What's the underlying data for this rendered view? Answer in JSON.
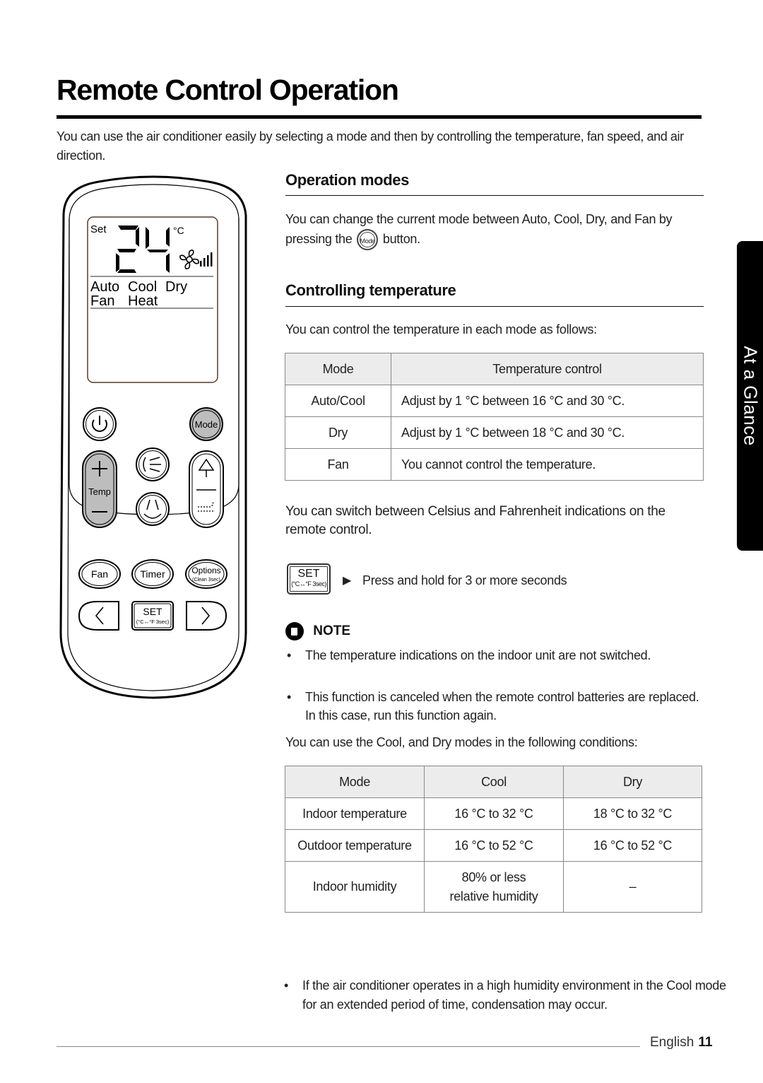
{
  "page": {
    "title": "Remote Control Operation",
    "intro": "You can use the air conditioner easily by selecting a mode and then by controlling the temperature, fan speed, and air direction.",
    "side_tab": "At a Glance",
    "footer": {
      "language": "English",
      "page_number": "11"
    }
  },
  "remote": {
    "lcd": {
      "set_label": "Set",
      "temperature": "24",
      "unit": "°C",
      "modes_row1": [
        "Auto",
        "Cool",
        "Dry"
      ],
      "modes_row2": [
        "Fan",
        "Heat"
      ]
    },
    "buttons": {
      "power_icon": "power-icon",
      "mode": "Mode",
      "temp": "Temp",
      "fan": "Fan",
      "timer": "Timer",
      "options": "Options",
      "options_sub": "(Clean 3sec)",
      "set": "SET",
      "set_sub": "(°C↔°F 3sec)"
    }
  },
  "operation_modes": {
    "heading": "Operation modes",
    "text_before": "You can change the current mode between Auto, Cool, Dry, and Fan by pressing the",
    "inline_button": "Mode",
    "text_after": "button."
  },
  "controlling_temperature": {
    "heading": "Controlling temperature",
    "lead": "You can control the temperature in each mode as follows:",
    "table": {
      "headers": [
        "Mode",
        "Temperature control"
      ],
      "rows": [
        [
          "Auto/Cool",
          "Adjust by 1 °C between 16 °C and 30 °C."
        ],
        [
          "Dry",
          "Adjust by 1 °C between 18 °C and 30 °C."
        ],
        [
          "Fan",
          "You cannot control the temperature."
        ]
      ]
    },
    "switch_text": "You can switch between Celsius and Fahrenheit indications on the remote control.",
    "set_button": {
      "label": "SET",
      "sub": "(°C↔°F 3sec)"
    },
    "instruction": "Press and hold for 3 or more seconds",
    "note": {
      "label": "NOTE",
      "items": [
        "The temperature indications on the indoor unit are not switched.",
        "This function is canceled when the remote control batteries are replaced. In this case, run this function again."
      ]
    },
    "conditions_lead": "You can use the Cool, and Dry modes in the following conditions:",
    "conditions_table": {
      "headers": [
        "Mode",
        "Cool",
        "Dry"
      ],
      "rows": [
        [
          "Indoor temperature",
          "16 °C to 32 °C",
          "18 °C to 32 °C"
        ],
        [
          "Outdoor temperature",
          "16 °C to 52 °C",
          "16 °C to 52 °C"
        ],
        [
          "Indoor humidity",
          "80% or less relative humidity",
          "–"
        ]
      ]
    },
    "warning": "If the air conditioner operates in a high humidity environment in the Cool mode for an extended period of time, condensation may occur."
  }
}
